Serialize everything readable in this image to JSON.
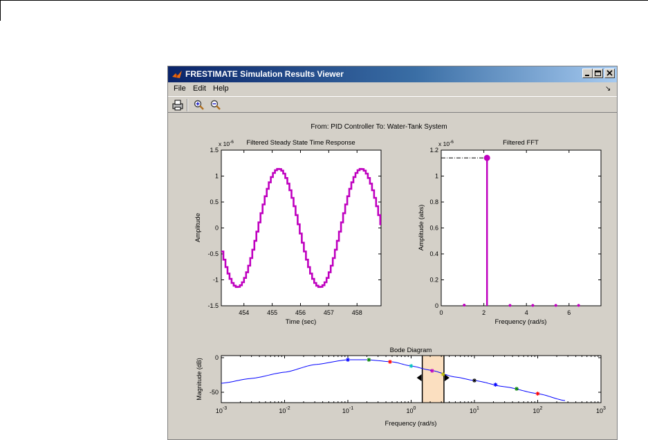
{
  "window": {
    "title": "FRESTIMATE Simulation Results Viewer"
  },
  "menu": {
    "items": [
      "File",
      "Edit",
      "Help"
    ]
  },
  "figure": {
    "super_title": "From: PID Controller  To: Water-Tank System",
    "time_plot": {
      "title": "Filtered Steady State Time Response",
      "xlabel": "Time (sec)",
      "ylabel": "Amplitude",
      "exponent": "x 10",
      "exponent_power": "-6",
      "xticks": [
        "454",
        "455",
        "456",
        "457",
        "458"
      ],
      "yticks": [
        "-1.5",
        "-1",
        "-0.5",
        "0",
        "0.5",
        "1",
        "1.5"
      ]
    },
    "fft_plot": {
      "title": "Filtered FFT",
      "xlabel": "Frequency (rad/s)",
      "ylabel": "Amplitude (abs)",
      "exponent": "x 10",
      "exponent_power": "-6",
      "xticks": [
        "0",
        "2",
        "4",
        "6"
      ],
      "yticks": [
        "0",
        "0.2",
        "0.4",
        "0.6",
        "0.8",
        "1",
        "1.2"
      ]
    },
    "bode_plot": {
      "title": "Bode Diagram",
      "xlabel": "Frequency (rad/s)",
      "ylabel": "Magnitude (dB)",
      "yticks": [
        "0",
        "-50"
      ],
      "xticks_base": "10",
      "xticks_pow": [
        "-3",
        "-2",
        "-1",
        "0",
        "1",
        "2",
        "3"
      ]
    }
  },
  "chart_data": [
    {
      "type": "line",
      "title": "Filtered Steady State Time Response",
      "xlabel": "Time (sec)",
      "ylabel": "Amplitude",
      "y_scale_factor": 1e-06,
      "xlim": [
        453.2,
        458.85
      ],
      "ylim": [
        -1.5,
        1.5
      ],
      "signal": {
        "amplitude": 1.14,
        "period": 2.92,
        "phase_time_of_peak": 455.2,
        "staircase_step": 0.073
      },
      "color": "#bf00bf"
    },
    {
      "type": "scatter",
      "title": "Filtered FFT",
      "xlabel": "Frequency (rad/s)",
      "ylabel": "Amplitude (abs)",
      "y_scale_factor": 1e-06,
      "xlim": [
        0,
        7.5
      ],
      "ylim": [
        0,
        1.2
      ],
      "stems": [
        {
          "x": 1.08,
          "y": 0.005
        },
        {
          "x": 2.15,
          "y": 1.14
        },
        {
          "x": 3.23,
          "y": 0.003
        },
        {
          "x": 4.3,
          "y": 0.003
        },
        {
          "x": 5.38,
          "y": 0.003
        },
        {
          "x": 6.45,
          "y": 0.003
        }
      ],
      "reference_line_y": 1.14,
      "color": "#bf00bf"
    },
    {
      "type": "line",
      "title": "Bode Diagram",
      "xlabel": "Frequency (rad/s)",
      "ylabel": "Magnitude (dB)",
      "x_scale": "log",
      "xlim": [
        0.001,
        1000
      ],
      "ylim": [
        -65,
        3
      ],
      "curve": [
        {
          "x": 0.001,
          "y": -37
        },
        {
          "x": 0.003,
          "y": -30
        },
        {
          "x": 0.01,
          "y": -21
        },
        {
          "x": 0.03,
          "y": -10
        },
        {
          "x": 0.1,
          "y": -3
        },
        {
          "x": 0.2,
          "y": -3
        },
        {
          "x": 0.5,
          "y": -6
        },
        {
          "x": 1,
          "y": -12
        },
        {
          "x": 2,
          "y": -18
        },
        {
          "x": 5,
          "y": -28
        },
        {
          "x": 10,
          "y": -33
        },
        {
          "x": 30,
          "y": -42
        },
        {
          "x": 100,
          "y": -52
        },
        {
          "x": 270,
          "y": -62
        }
      ],
      "markers": [
        {
          "x": 0.1,
          "y": -3,
          "color": "#0000ff"
        },
        {
          "x": 0.215,
          "y": -3,
          "color": "#008000"
        },
        {
          "x": 0.464,
          "y": -6,
          "color": "#ff0000"
        },
        {
          "x": 1.0,
          "y": -12,
          "color": "#00bfbf"
        },
        {
          "x": 2.15,
          "y": -19,
          "color": "#bf00bf"
        },
        {
          "x": 3.2,
          "y": -24,
          "color": "#bfbf00"
        },
        {
          "x": 10.0,
          "y": -33,
          "color": "#000000"
        },
        {
          "x": 21.5,
          "y": -39,
          "color": "#0000ff"
        },
        {
          "x": 46.4,
          "y": -45,
          "color": "#008000"
        },
        {
          "x": 100,
          "y": -52,
          "color": "#ff0000"
        }
      ],
      "highlight_band": [
        1.5,
        3.3
      ],
      "line_color": "#0000ff"
    }
  ]
}
